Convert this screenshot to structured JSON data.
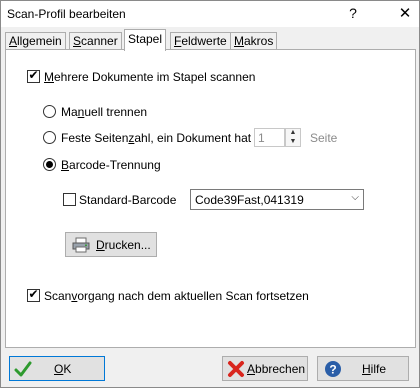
{
  "window": {
    "title": "Scan-Profil bearbeiten",
    "help_glyph": "?",
    "close_glyph": "✕"
  },
  "tabs": [
    {
      "pre": "",
      "key": "A",
      "post": "llgemein"
    },
    {
      "pre": "",
      "key": "S",
      "post": "canner"
    },
    {
      "pre": "",
      "key": "",
      "post": "Stapel"
    },
    {
      "pre": "",
      "key": "F",
      "post": "eldwerte"
    },
    {
      "pre": "",
      "key": "M",
      "post": "akros"
    }
  ],
  "options": {
    "multi_doc": {
      "pre": "",
      "key": "M",
      "post": "ehrere Dokumente im Stapel scannen",
      "checked": true
    },
    "manual": {
      "pre": "Ma",
      "key": "n",
      "post": "uell trennen"
    },
    "fixed_pages": {
      "pre": "Feste Seiten",
      "key": "z",
      "post": "ahl, ein Dokument hat"
    },
    "fixed_pages_value": "1",
    "fixed_pages_unit": "Seite",
    "barcode": {
      "pre": "",
      "key": "B",
      "post": "arcode-Trennung"
    },
    "selected_radio": "barcode",
    "standard_barcode": {
      "pre": "",
      "key": "",
      "post": "Standard-Barcode",
      "checked": false
    },
    "barcode_type": "Code39Fast,041319",
    "print_button": {
      "pre": "",
      "key": "D",
      "post": "rucken..."
    },
    "continue_scan": {
      "pre": "Scan",
      "key": "v",
      "post": "organg nach dem aktuellen Scan fortsetzen",
      "checked": true
    }
  },
  "buttons": {
    "ok": {
      "pre": "",
      "key": "O",
      "post": "K"
    },
    "cancel": {
      "pre": "",
      "key": "A",
      "post": "bbrechen"
    },
    "help": {
      "pre": "",
      "key": "H",
      "post": "ilfe"
    }
  },
  "icons": {
    "ok": "check-icon",
    "cancel": "cancel-x-icon",
    "help": "help-icon",
    "print": "printer-icon"
  },
  "colors": {
    "ok_check": "#2e9a2e",
    "cancel_x": "#d9251d",
    "help_blue": "#2a5ea8"
  }
}
